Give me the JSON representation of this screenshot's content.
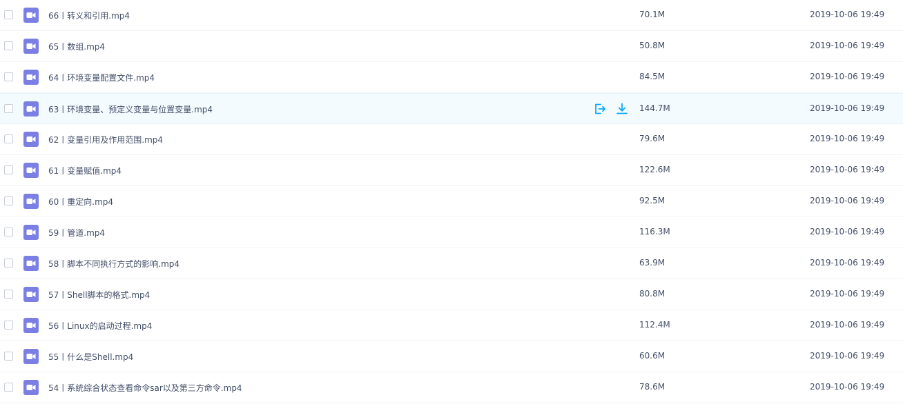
{
  "accent_color": "#06a7ff",
  "icon_color": "#7b7fe4",
  "files": [
    {
      "name": "66丨转义和引用.mp4",
      "size": "70.1M",
      "date": "2019-10-06 19:49",
      "icon": "video-icon"
    },
    {
      "name": "65丨数组.mp4",
      "size": "50.8M",
      "date": "2019-10-06 19:49",
      "icon": "video-icon"
    },
    {
      "name": "64丨环境变量配置文件.mp4",
      "size": "84.5M",
      "date": "2019-10-06 19:49",
      "icon": "video-icon"
    },
    {
      "name": "63丨环境变量、预定义变量与位置变量.mp4",
      "size": "144.7M",
      "date": "2019-10-06 19:49",
      "icon": "video-icon",
      "hovered": true,
      "actions": [
        "share-icon",
        "download-icon"
      ]
    },
    {
      "name": "62丨变量引用及作用范围.mp4",
      "size": "79.6M",
      "date": "2019-10-06 19:49",
      "icon": "video-icon"
    },
    {
      "name": "61丨变量赋值.mp4",
      "size": "122.6M",
      "date": "2019-10-06 19:49",
      "icon": "video-icon"
    },
    {
      "name": "60丨重定向.mp4",
      "size": "92.5M",
      "date": "2019-10-06 19:49",
      "icon": "video-icon"
    },
    {
      "name": "59丨管道.mp4",
      "size": "116.3M",
      "date": "2019-10-06 19:49",
      "icon": "video-icon"
    },
    {
      "name": "58丨脚本不同执行方式的影响.mp4",
      "size": "63.9M",
      "date": "2019-10-06 19:49",
      "icon": "video-icon"
    },
    {
      "name": "57丨Shell脚本的格式.mp4",
      "size": "80.8M",
      "date": "2019-10-06 19:49",
      "icon": "video-icon"
    },
    {
      "name": "56丨Linux的启动过程.mp4",
      "size": "112.4M",
      "date": "2019-10-06 19:49",
      "icon": "video-icon"
    },
    {
      "name": "55丨什么是Shell.mp4",
      "size": "60.6M",
      "date": "2019-10-06 19:49",
      "icon": "video-icon"
    },
    {
      "name": "54丨系统综合状态查看命令sar以及第三方命令.mp4",
      "size": "78.6M",
      "date": "2019-10-06 19:49",
      "icon": "video-icon"
    }
  ]
}
